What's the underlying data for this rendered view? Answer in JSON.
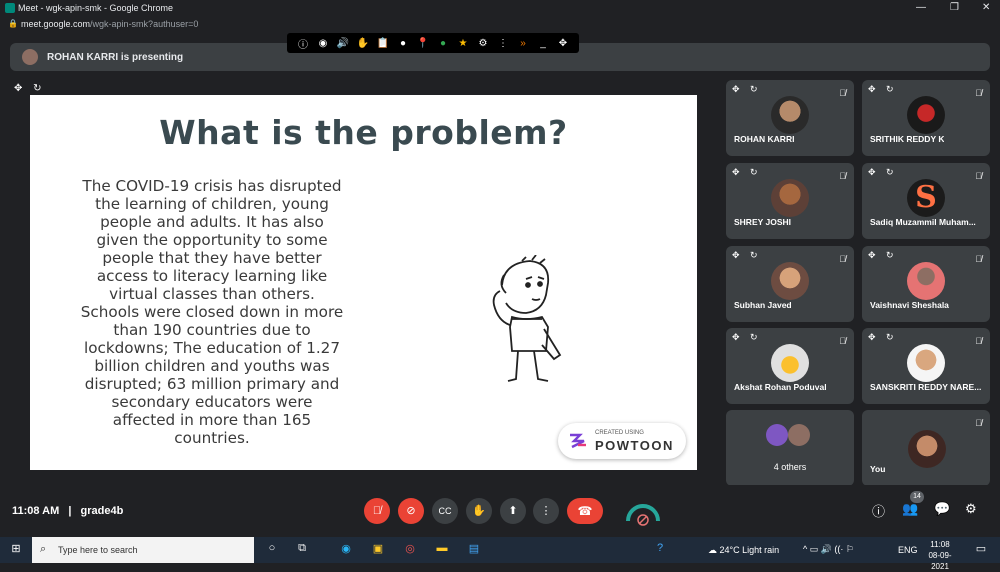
{
  "browser": {
    "title": "Meet - wgk-apin-smk - Google Chrome",
    "url_host": "meet.google.com",
    "url_path": "/wgk-apin-smk?authuser=0"
  },
  "presenting_banner": "ROHAN KARRI is presenting",
  "slide": {
    "title": "What is the problem?",
    "body": "The COVID-19 crisis has disrupted the learning of children, young people and adults. It has also given the opportunity to some people that they have better access to literacy learning like virtual classes than others. Schools were closed down in more than 190 countries due to lockdowns; The education of 1.27 billion children and youths was disrupted; 63 million primary and secondary educators were affected in more than 165 countries.",
    "badge_small": "CREATED USING",
    "badge_big": "POWTOON"
  },
  "participants": [
    {
      "name": "ROHAN KARRI"
    },
    {
      "name": "SRITHIK REDDY K"
    },
    {
      "name": "SHREY JOSHI"
    },
    {
      "name": "Sadiq Muzammil Muham..."
    },
    {
      "name": "Subhan Javed"
    },
    {
      "name": "Vaishnavi Sheshala"
    },
    {
      "name": "Akshat Rohan Poduval"
    },
    {
      "name": "SANSKRITI REDDY NARE..."
    },
    {
      "name": "4 others"
    },
    {
      "name": "You"
    }
  ],
  "meeting": {
    "time": "11:08 AM",
    "separator": "|",
    "code": "grade4b",
    "participant_count": "14"
  },
  "taskbar": {
    "search_placeholder": "Type here to search",
    "weather": "24°C  Light rain",
    "lang": "ENG",
    "clock_time": "11:08",
    "clock_date": "08-09-2021"
  },
  "colors": {
    "meet_bg": "#202124",
    "tile_bg": "#3c4043",
    "danger": "#ea4335",
    "taskbar": "#1f2b3a"
  }
}
